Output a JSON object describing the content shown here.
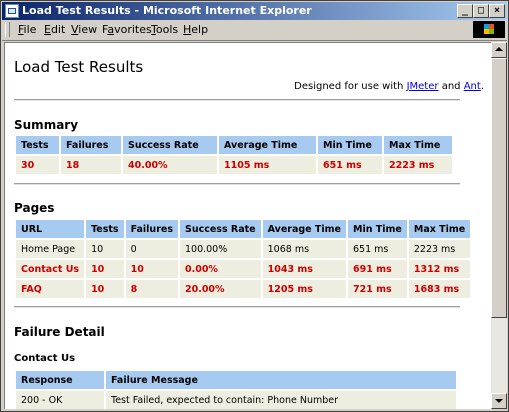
{
  "window": {
    "title": "Load Test Results - Microsoft Internet Explorer"
  },
  "menu": [
    {
      "key": "F",
      "rest": "ile"
    },
    {
      "key": "E",
      "rest": "dit"
    },
    {
      "key": "V",
      "rest": "iew"
    },
    {
      "pre": "F",
      "key": "a",
      "rest": "vorites"
    },
    {
      "key": "T",
      "rest": "ools"
    },
    {
      "key": "H",
      "rest": "elp"
    }
  ],
  "page": {
    "title": "Load Test Results",
    "credit_prefix": "Designed for use with",
    "credit_link1": "JMeter",
    "credit_mid": "and",
    "credit_link2": "Ant",
    "credit_suffix": "."
  },
  "summary": {
    "heading": "Summary",
    "headers": [
      "Tests",
      "Failures",
      "Success Rate",
      "Average Time",
      "Min Time",
      "Max Time"
    ],
    "row": [
      "30",
      "18",
      "40.00%",
      "1105 ms",
      "651 ms",
      "2223 ms"
    ]
  },
  "pages": {
    "heading": "Pages",
    "headers": [
      "URL",
      "Tests",
      "Failures",
      "Success Rate",
      "Average Time",
      "Min Time",
      "Max Time"
    ],
    "rows": [
      {
        "fail": false,
        "cells": [
          "Home Page",
          "10",
          "0",
          "100.00%",
          "1068 ms",
          "651 ms",
          "2223 ms"
        ]
      },
      {
        "fail": true,
        "cells": [
          "Contact Us",
          "10",
          "10",
          "0.00%",
          "1043 ms",
          "691 ms",
          "1312 ms"
        ]
      },
      {
        "fail": true,
        "cells": [
          "FAQ",
          "10",
          "8",
          "20.00%",
          "1205 ms",
          "721 ms",
          "1683 ms"
        ]
      }
    ]
  },
  "failure_detail": {
    "heading": "Failure Detail",
    "subheading": "Contact Us",
    "headers": [
      "Response",
      "Failure Message"
    ],
    "rows": [
      [
        "200 - OK",
        "Test Failed, expected to contain: Phone Number"
      ]
    ]
  }
}
